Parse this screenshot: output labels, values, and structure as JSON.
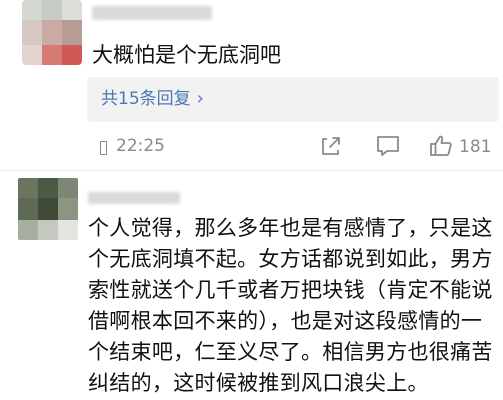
{
  "comment1": {
    "text": "大概怕是个无底洞吧",
    "reply_summary": "共15条回复",
    "reply_chevron": "›",
    "time": "22:25",
    "like_count": "181"
  },
  "comment2": {
    "text": "个人觉得，那么多年也是有感情了，只是这个无底洞填不起。女方话都说到如此，男方索性就送个几千或者万把块钱（肯定不能说借啊根本回不来的），也是对这段感情的一个结束吧，仁至义尽了。相信男方也很痛苦纠结的，这时候被推到风口浪尖上。"
  },
  "icons": {
    "device": "phone-icon",
    "share": "share-icon",
    "comment": "comment-icon",
    "like": "thumbs-up-icon"
  },
  "colors": {
    "link": "#4b78b5",
    "meta": "#8a8a8a",
    "reply_bg": "#f2f2f2"
  }
}
